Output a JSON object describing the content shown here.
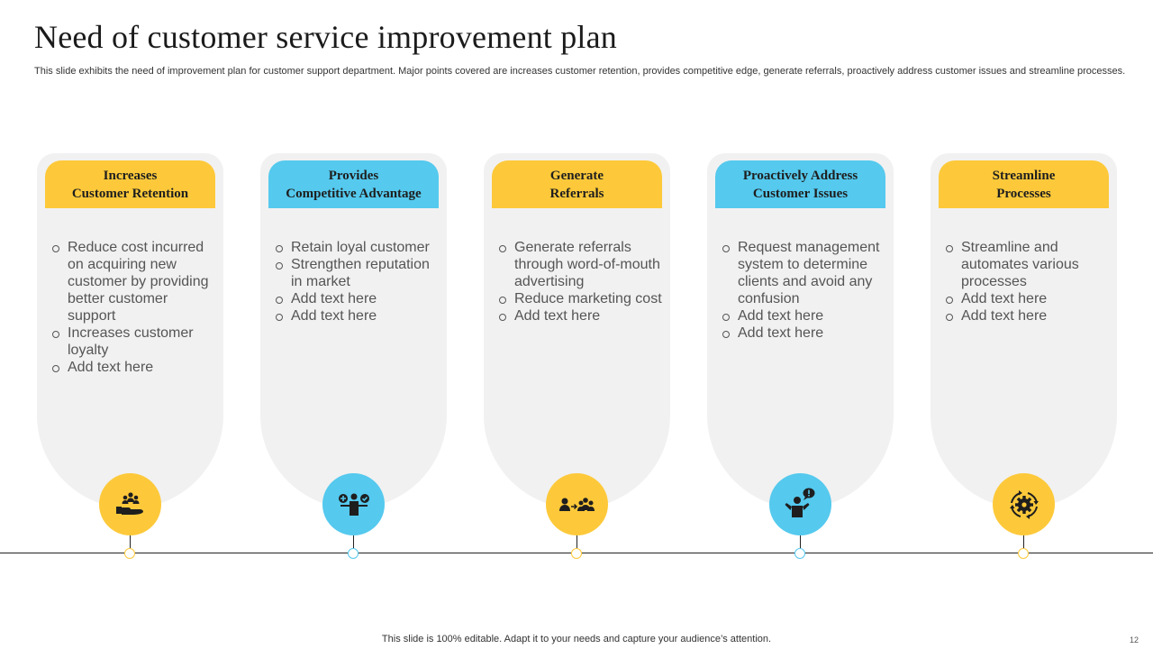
{
  "slide": {
    "title": "Need of customer service improvement plan",
    "subtitle": "This slide exhibits the need of improvement plan for customer support department. Major points covered are increases customer retention, provides competitive edge, generate referrals, proactively address customer issues and streamline processes.",
    "footer": "This slide is 100% editable. Adapt it to your needs and capture your audience’s attention.",
    "page_number": "12"
  },
  "colors": {
    "yellow": "#fdc93a",
    "blue": "#55c9ee",
    "card_bg": "#f1f1f1"
  },
  "cards": [
    {
      "title_lines": [
        "Increases",
        "Customer Retention"
      ],
      "accent": "yellow",
      "icon": "hand-holding-people-icon",
      "bullets": [
        "Reduce cost incurred on acquiring new customer by providing better customer support",
        "Increases customer loyalty",
        "Add text here"
      ]
    },
    {
      "title_lines": [
        "Provides",
        "Competitive Advantage"
      ],
      "accent": "blue",
      "icon": "person-balance-icon",
      "bullets": [
        "Retain loyal customer",
        "Strengthen reputation in market",
        "Add text here",
        "Add text here"
      ]
    },
    {
      "title_lines": [
        "Generate",
        "Referrals"
      ],
      "accent": "yellow",
      "icon": "referral-people-icon",
      "bullets": [
        "Generate referrals through word-of-mouth advertising",
        "Reduce marketing cost",
        "Add text here"
      ]
    },
    {
      "title_lines": [
        "Proactively Address",
        "Customer Issues"
      ],
      "accent": "blue",
      "icon": "person-alert-icon",
      "bullets": [
        "Request management system to determine clients and avoid any confusion",
        "Add text here",
        "Add text here"
      ]
    },
    {
      "title_lines": [
        "Streamline",
        "Processes"
      ],
      "accent": "yellow",
      "icon": "gear-cycle-icon",
      "bullets": [
        "Streamline and automates various processes",
        "Add text here",
        "Add text here"
      ]
    }
  ]
}
